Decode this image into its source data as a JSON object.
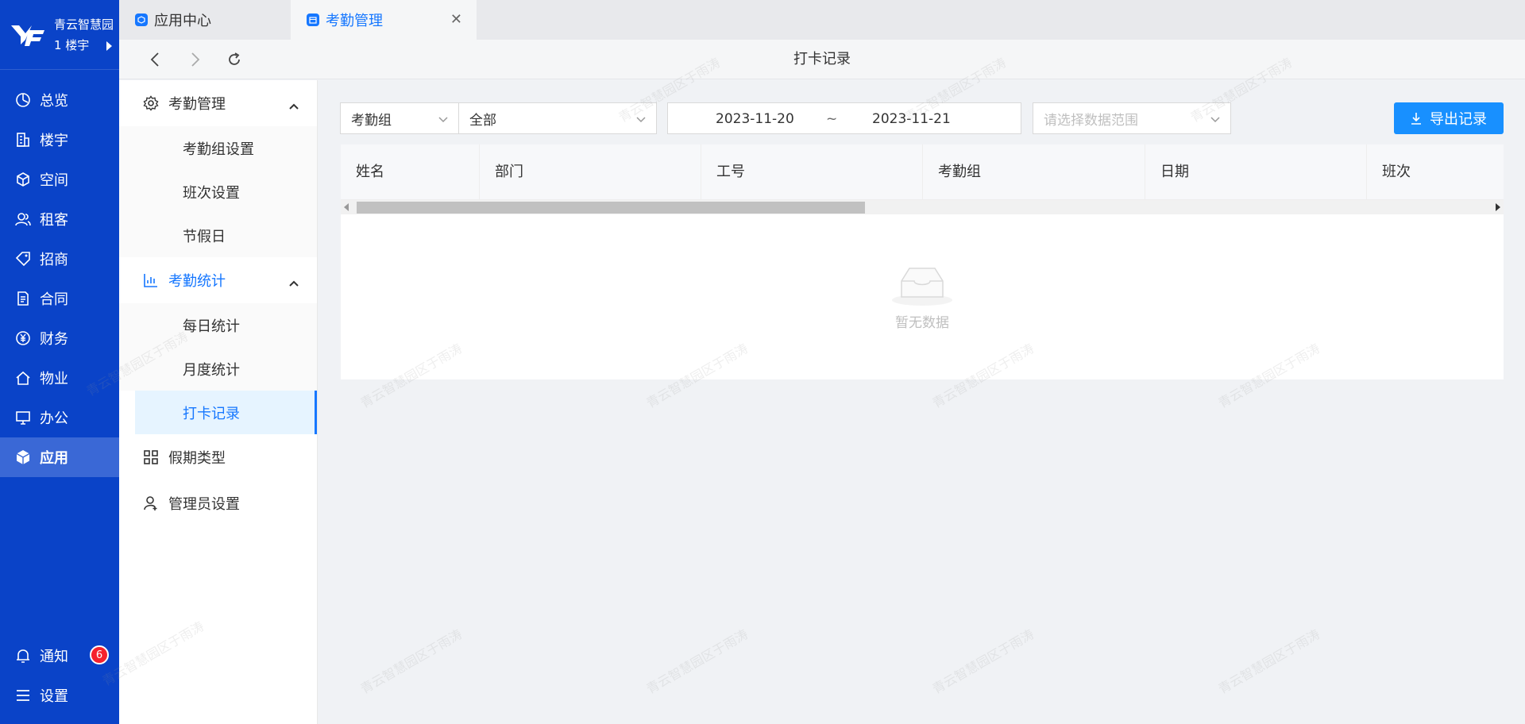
{
  "sidebar": {
    "brand_line1": "青云智慧园",
    "brand_line2": "1 楼宇",
    "items": [
      {
        "label": "总览",
        "icon": "dashboard-icon"
      },
      {
        "label": "楼宇",
        "icon": "building-icon"
      },
      {
        "label": "空间",
        "icon": "cube-icon"
      },
      {
        "label": "租客",
        "icon": "users-icon"
      },
      {
        "label": "招商",
        "icon": "tag-icon"
      },
      {
        "label": "合同",
        "icon": "document-icon"
      },
      {
        "label": "财务",
        "icon": "yen-icon"
      },
      {
        "label": "物业",
        "icon": "home-icon"
      },
      {
        "label": "办公",
        "icon": "monitor-icon"
      },
      {
        "label": "应用",
        "icon": "app-cube-icon",
        "active": true
      }
    ],
    "bottom": [
      {
        "label": "通知",
        "icon": "bell-icon",
        "badge": "6"
      },
      {
        "label": "设置",
        "icon": "menu-icon"
      }
    ]
  },
  "tabs": [
    {
      "label": "应用中心",
      "active": false
    },
    {
      "label": "考勤管理",
      "active": true
    }
  ],
  "toolbar": {
    "page_title": "打卡记录"
  },
  "submenu": {
    "group1": {
      "label": "考勤管理",
      "items": [
        "考勤组设置",
        "班次设置",
        "节假日"
      ]
    },
    "group2": {
      "label": "考勤统计",
      "items": [
        "每日统计",
        "月度统计",
        "打卡记录"
      ],
      "selected": "打卡记录"
    },
    "group3": {
      "label": "假期类型"
    },
    "group4": {
      "label": "管理员设置"
    }
  },
  "filters": {
    "group_select": "考勤组",
    "scope_select": "全部",
    "date_start": "2023-11-20",
    "date_sep": "~",
    "date_end": "2023-11-21",
    "range_placeholder": "请选择数据范围",
    "export_label": "导出记录"
  },
  "table": {
    "columns": [
      "姓名",
      "部门",
      "工号",
      "考勤组",
      "日期",
      "班次"
    ],
    "rows": [],
    "empty_text": "暂无数据"
  },
  "watermark_text": "青云智慧园区于雨涛",
  "colors": {
    "sidebar": "#0a43c8",
    "accent": "#1677ff",
    "badge": "#f5222d"
  }
}
